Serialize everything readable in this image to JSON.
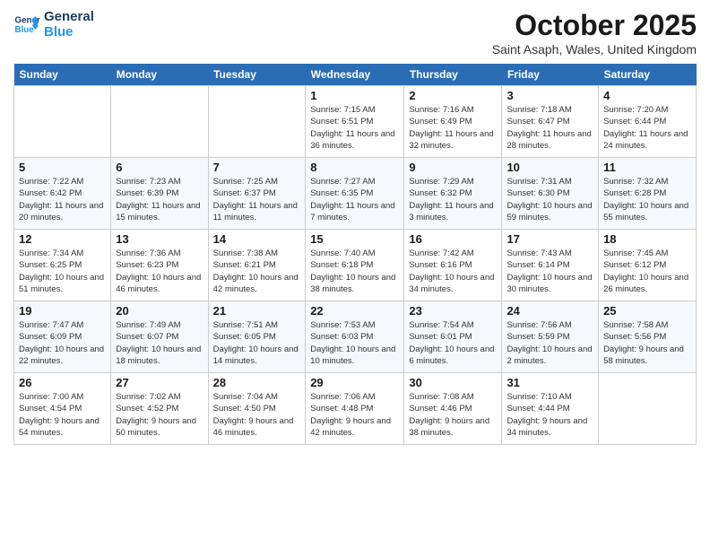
{
  "header": {
    "logo_line1": "General",
    "logo_line2": "Blue",
    "title": "October 2025",
    "location": "Saint Asaph, Wales, United Kingdom"
  },
  "weekdays": [
    "Sunday",
    "Monday",
    "Tuesday",
    "Wednesday",
    "Thursday",
    "Friday",
    "Saturday"
  ],
  "weeks": [
    [
      {
        "num": "",
        "sunrise": "",
        "sunset": "",
        "daylight": ""
      },
      {
        "num": "",
        "sunrise": "",
        "sunset": "",
        "daylight": ""
      },
      {
        "num": "",
        "sunrise": "",
        "sunset": "",
        "daylight": ""
      },
      {
        "num": "1",
        "sunrise": "Sunrise: 7:15 AM",
        "sunset": "Sunset: 6:51 PM",
        "daylight": "Daylight: 11 hours and 36 minutes."
      },
      {
        "num": "2",
        "sunrise": "Sunrise: 7:16 AM",
        "sunset": "Sunset: 6:49 PM",
        "daylight": "Daylight: 11 hours and 32 minutes."
      },
      {
        "num": "3",
        "sunrise": "Sunrise: 7:18 AM",
        "sunset": "Sunset: 6:47 PM",
        "daylight": "Daylight: 11 hours and 28 minutes."
      },
      {
        "num": "4",
        "sunrise": "Sunrise: 7:20 AM",
        "sunset": "Sunset: 6:44 PM",
        "daylight": "Daylight: 11 hours and 24 minutes."
      }
    ],
    [
      {
        "num": "5",
        "sunrise": "Sunrise: 7:22 AM",
        "sunset": "Sunset: 6:42 PM",
        "daylight": "Daylight: 11 hours and 20 minutes."
      },
      {
        "num": "6",
        "sunrise": "Sunrise: 7:23 AM",
        "sunset": "Sunset: 6:39 PM",
        "daylight": "Daylight: 11 hours and 15 minutes."
      },
      {
        "num": "7",
        "sunrise": "Sunrise: 7:25 AM",
        "sunset": "Sunset: 6:37 PM",
        "daylight": "Daylight: 11 hours and 11 minutes."
      },
      {
        "num": "8",
        "sunrise": "Sunrise: 7:27 AM",
        "sunset": "Sunset: 6:35 PM",
        "daylight": "Daylight: 11 hours and 7 minutes."
      },
      {
        "num": "9",
        "sunrise": "Sunrise: 7:29 AM",
        "sunset": "Sunset: 6:32 PM",
        "daylight": "Daylight: 11 hours and 3 minutes."
      },
      {
        "num": "10",
        "sunrise": "Sunrise: 7:31 AM",
        "sunset": "Sunset: 6:30 PM",
        "daylight": "Daylight: 10 hours and 59 minutes."
      },
      {
        "num": "11",
        "sunrise": "Sunrise: 7:32 AM",
        "sunset": "Sunset: 6:28 PM",
        "daylight": "Daylight: 10 hours and 55 minutes."
      }
    ],
    [
      {
        "num": "12",
        "sunrise": "Sunrise: 7:34 AM",
        "sunset": "Sunset: 6:25 PM",
        "daylight": "Daylight: 10 hours and 51 minutes."
      },
      {
        "num": "13",
        "sunrise": "Sunrise: 7:36 AM",
        "sunset": "Sunset: 6:23 PM",
        "daylight": "Daylight: 10 hours and 46 minutes."
      },
      {
        "num": "14",
        "sunrise": "Sunrise: 7:38 AM",
        "sunset": "Sunset: 6:21 PM",
        "daylight": "Daylight: 10 hours and 42 minutes."
      },
      {
        "num": "15",
        "sunrise": "Sunrise: 7:40 AM",
        "sunset": "Sunset: 6:18 PM",
        "daylight": "Daylight: 10 hours and 38 minutes."
      },
      {
        "num": "16",
        "sunrise": "Sunrise: 7:42 AM",
        "sunset": "Sunset: 6:16 PM",
        "daylight": "Daylight: 10 hours and 34 minutes."
      },
      {
        "num": "17",
        "sunrise": "Sunrise: 7:43 AM",
        "sunset": "Sunset: 6:14 PM",
        "daylight": "Daylight: 10 hours and 30 minutes."
      },
      {
        "num": "18",
        "sunrise": "Sunrise: 7:45 AM",
        "sunset": "Sunset: 6:12 PM",
        "daylight": "Daylight: 10 hours and 26 minutes."
      }
    ],
    [
      {
        "num": "19",
        "sunrise": "Sunrise: 7:47 AM",
        "sunset": "Sunset: 6:09 PM",
        "daylight": "Daylight: 10 hours and 22 minutes."
      },
      {
        "num": "20",
        "sunrise": "Sunrise: 7:49 AM",
        "sunset": "Sunset: 6:07 PM",
        "daylight": "Daylight: 10 hours and 18 minutes."
      },
      {
        "num": "21",
        "sunrise": "Sunrise: 7:51 AM",
        "sunset": "Sunset: 6:05 PM",
        "daylight": "Daylight: 10 hours and 14 minutes."
      },
      {
        "num": "22",
        "sunrise": "Sunrise: 7:53 AM",
        "sunset": "Sunset: 6:03 PM",
        "daylight": "Daylight: 10 hours and 10 minutes."
      },
      {
        "num": "23",
        "sunrise": "Sunrise: 7:54 AM",
        "sunset": "Sunset: 6:01 PM",
        "daylight": "Daylight: 10 hours and 6 minutes."
      },
      {
        "num": "24",
        "sunrise": "Sunrise: 7:56 AM",
        "sunset": "Sunset: 5:59 PM",
        "daylight": "Daylight: 10 hours and 2 minutes."
      },
      {
        "num": "25",
        "sunrise": "Sunrise: 7:58 AM",
        "sunset": "Sunset: 5:56 PM",
        "daylight": "Daylight: 9 hours and 58 minutes."
      }
    ],
    [
      {
        "num": "26",
        "sunrise": "Sunrise: 7:00 AM",
        "sunset": "Sunset: 4:54 PM",
        "daylight": "Daylight: 9 hours and 54 minutes."
      },
      {
        "num": "27",
        "sunrise": "Sunrise: 7:02 AM",
        "sunset": "Sunset: 4:52 PM",
        "daylight": "Daylight: 9 hours and 50 minutes."
      },
      {
        "num": "28",
        "sunrise": "Sunrise: 7:04 AM",
        "sunset": "Sunset: 4:50 PM",
        "daylight": "Daylight: 9 hours and 46 minutes."
      },
      {
        "num": "29",
        "sunrise": "Sunrise: 7:06 AM",
        "sunset": "Sunset: 4:48 PM",
        "daylight": "Daylight: 9 hours and 42 minutes."
      },
      {
        "num": "30",
        "sunrise": "Sunrise: 7:08 AM",
        "sunset": "Sunset: 4:46 PM",
        "daylight": "Daylight: 9 hours and 38 minutes."
      },
      {
        "num": "31",
        "sunrise": "Sunrise: 7:10 AM",
        "sunset": "Sunset: 4:44 PM",
        "daylight": "Daylight: 9 hours and 34 minutes."
      },
      {
        "num": "",
        "sunrise": "",
        "sunset": "",
        "daylight": ""
      }
    ]
  ]
}
